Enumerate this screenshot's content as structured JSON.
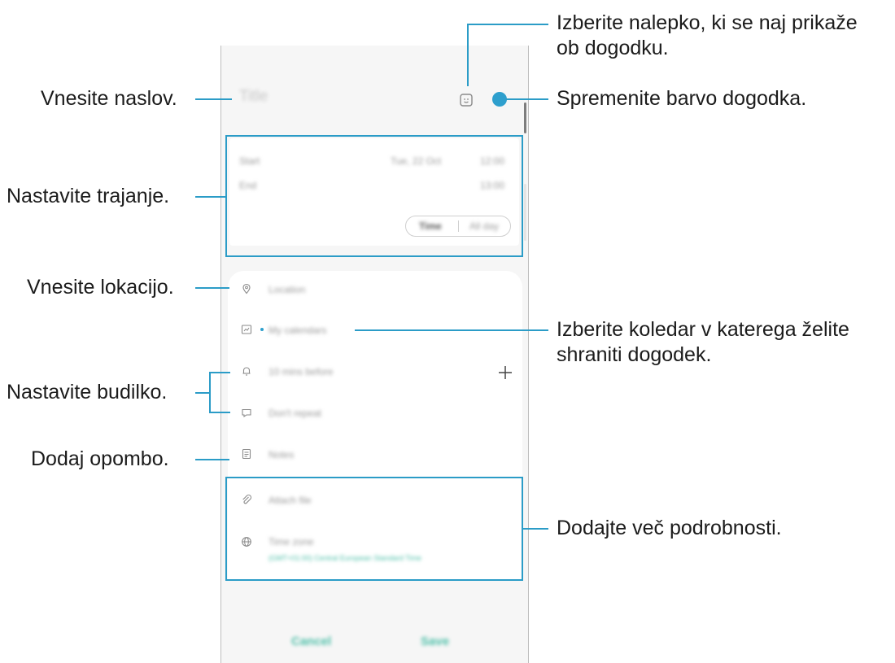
{
  "screen": {
    "title_placeholder": "Title",
    "accent_color": "#2b9cc7",
    "event_color": "#2e9fcd",
    "time": {
      "start_label": "Start",
      "start_date": "Tue, 22 Oct",
      "start_time": "12:00",
      "end_label": "End",
      "end_time": "13:00",
      "mode_time": "Time",
      "mode_all_day": "All day"
    },
    "rows": {
      "location": "Location",
      "calendar": "My calendars",
      "alarm": "10 mins before",
      "repeat": "Don't repeat",
      "notes": "Notes",
      "attach": "Attach file",
      "timezone": "Time zone",
      "timezone_value": "(GMT+01:00) Central European Standard Time"
    },
    "buttons": {
      "cancel": "Cancel",
      "save": "Save"
    }
  },
  "callouts": {
    "sticker": "Izberite nalepko, ki se naj prikaže ob dogodku.",
    "sticker_line1": "Izberite nalepko, ki se naj prikaže",
    "sticker_line2": "ob dogodku.",
    "title": "Vnesite naslov.",
    "color": "Spremenite barvo dogodka.",
    "duration": "Nastavite trajanje.",
    "location": "Vnesite lokacijo.",
    "calendar_line1": "Izberite koledar v katerega želite",
    "calendar_line2": "shraniti dogodek.",
    "alarm": "Nastavite budilko.",
    "note": "Dodaj opombo.",
    "details": "Dodajte več podrobnosti."
  }
}
